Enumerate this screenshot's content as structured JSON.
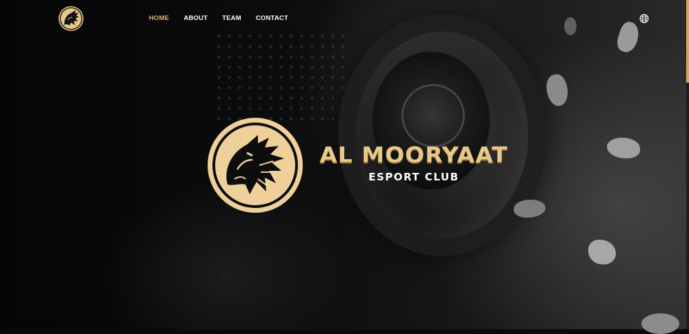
{
  "brand": {
    "title": "AL MOORYAAT",
    "subtitle": "ESPORT CLUB",
    "accent_color": "#e9c98a",
    "logo_icon": "wolf-head-emblem"
  },
  "nav": {
    "items": [
      {
        "label": "HOME",
        "active": true
      },
      {
        "label": "ABOUT",
        "active": false
      },
      {
        "label": "TEAM",
        "active": false
      },
      {
        "label": "CONTACT",
        "active": false
      }
    ],
    "active_color": "#d9b77a",
    "language_icon": "globe-icon"
  }
}
